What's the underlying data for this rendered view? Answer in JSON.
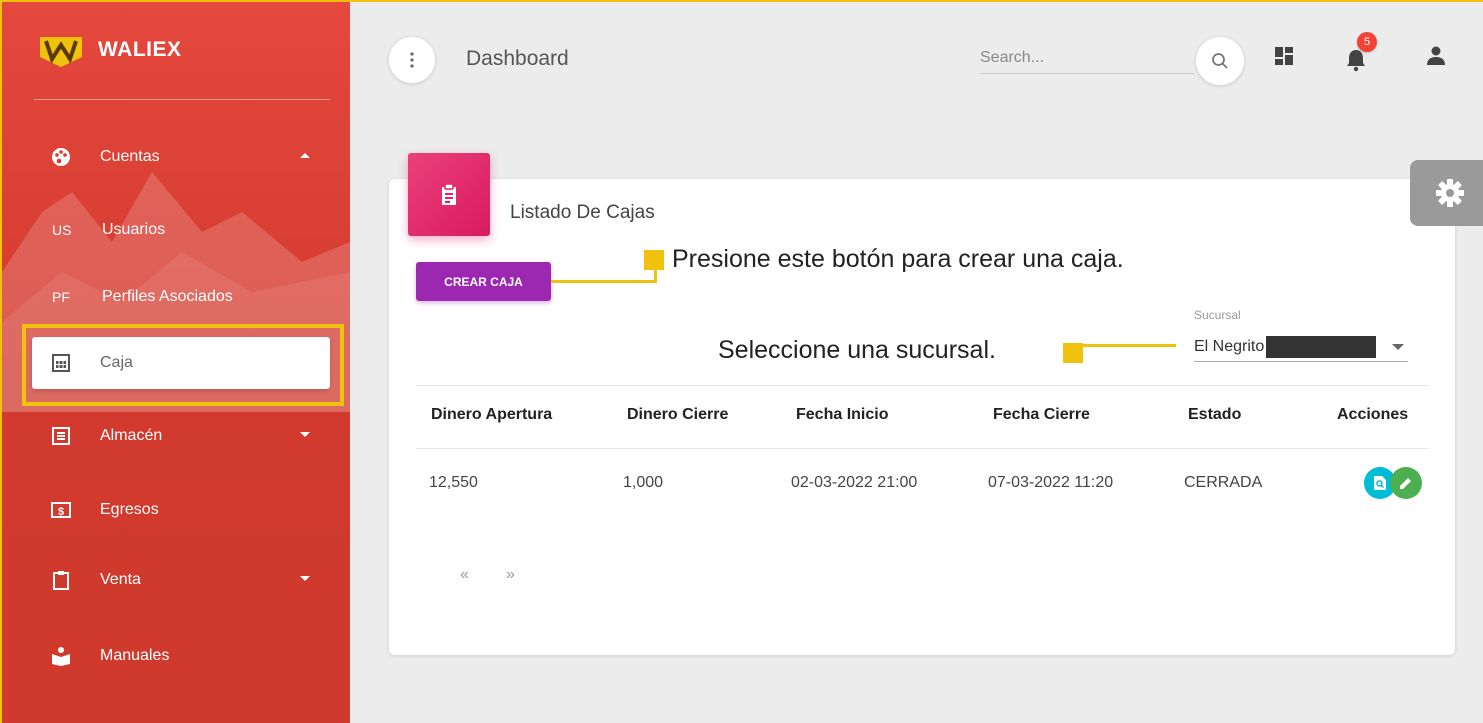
{
  "brand": {
    "name": "WALIEX"
  },
  "sidebar": {
    "items": [
      {
        "label": "Cuentas",
        "icon": "palette-icon",
        "abbr": ""
      },
      {
        "label": "Usuarios",
        "abbr": "US"
      },
      {
        "label": "Perfiles Asociados",
        "abbr": "PF"
      },
      {
        "label": "Caja",
        "icon": "calculator-icon",
        "abbr": ""
      },
      {
        "label": "Almacén",
        "icon": "list-icon",
        "abbr": ""
      },
      {
        "label": "Egresos",
        "icon": "money-icon",
        "abbr": ""
      },
      {
        "label": "Venta",
        "icon": "clipboard-icon",
        "abbr": ""
      },
      {
        "label": "Manuales",
        "icon": "reader-icon",
        "abbr": ""
      }
    ]
  },
  "header": {
    "title": "Dashboard",
    "search_placeholder": "Search...",
    "notification_count": "5"
  },
  "card": {
    "title": "Listado De Cajas",
    "create_button": "CREAR CAJA"
  },
  "annotations": {
    "create": "Presione este botón para crear una caja.",
    "select": "Seleccione una sucursal."
  },
  "filter": {
    "label": "Sucursal",
    "value": "El Negrito"
  },
  "table": {
    "headers": [
      "Dinero Apertura",
      "Dinero Cierre",
      "Fecha Inicio",
      "Fecha Cierre",
      "Estado",
      "Acciones"
    ],
    "rows": [
      [
        "12,550",
        "1,000",
        "02-03-2022 21:00",
        "07-03-2022 11:20",
        "CERRADA"
      ]
    ]
  },
  "pagination": {
    "prev": "«",
    "next": "»"
  },
  "colors": {
    "sidebar": "#d23a2e",
    "accent_purple": "#9c27b0",
    "accent_pink": "#e91e63",
    "highlight": "#f0c20e",
    "view_action": "#00bcd4",
    "edit_action": "#4caf50"
  }
}
